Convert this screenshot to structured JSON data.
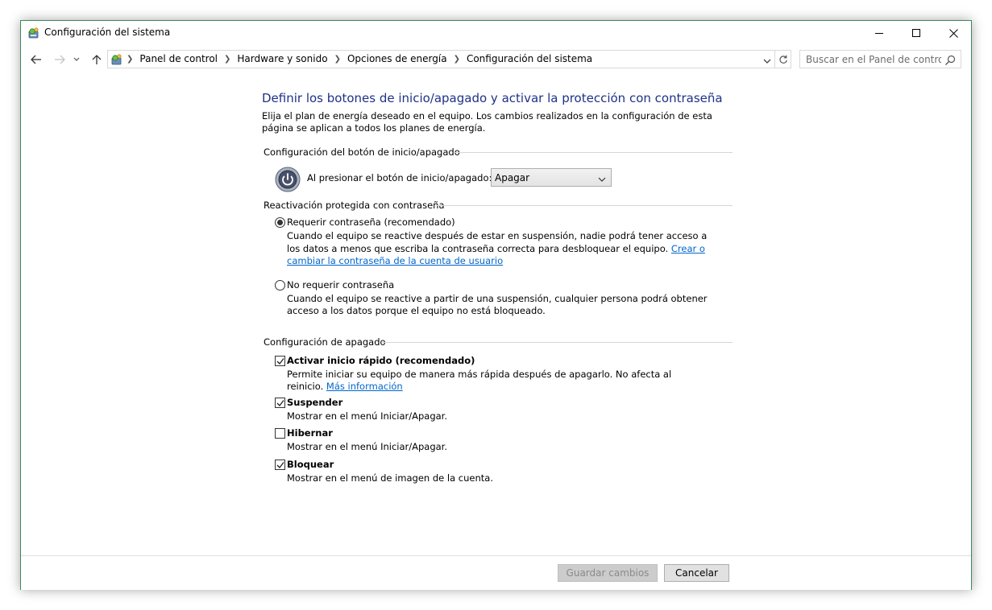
{
  "window": {
    "title": "Configuración del sistema",
    "accent_color": "#3b8b5b"
  },
  "titlebar": {
    "icon": "control-panel-icon",
    "minimize_icon": "minimize-icon",
    "maximize_icon": "maximize-icon",
    "close_icon": "close-icon"
  },
  "address": {
    "breadcrumbs": [
      "Panel de control",
      "Hardware y sonido",
      "Opciones de energía",
      "Configuración del sistema"
    ],
    "search_placeholder": "Buscar en el Panel de control"
  },
  "main": {
    "heading": "Definir los botones de inicio/apagado y activar la protección con contraseña",
    "description": "Elija el plan de energía deseado en el equipo. Los cambios realizados en la configuración de esta página se aplican a todos los planes de energía.",
    "power_group": {
      "title": "Configuración del botón de inicio/apagado",
      "label": "Al presionar el botón de inicio/apagado:",
      "selected": "Apagar"
    },
    "password_group": {
      "title": "Reactivación protegida con contraseña",
      "options": [
        {
          "label": "Requerir contraseña (recomendado)",
          "selected": true,
          "desc": "Cuando el equipo se reactive después de estar en suspensión, nadie podrá tener acceso a los datos a menos que escriba la contraseña correcta para desbloquear el equipo. ",
          "link": "Crear o cambiar la contraseña de la cuenta de usuario"
        },
        {
          "label": "No requerir contraseña",
          "selected": false,
          "desc": "Cuando el equipo se reactive a partir de una suspensión, cualquier persona podrá obtener acceso a los datos porque el equipo no está bloqueado."
        }
      ]
    },
    "shutdown_group": {
      "title": "Configuración de apagado",
      "items": [
        {
          "label": "Activar inicio rápido (recomendado)",
          "checked": true,
          "desc": "Permite iniciar su equipo de manera más rápida después de apagarlo. No afecta al reinicio. ",
          "link": "Más información"
        },
        {
          "label": "Suspender",
          "checked": true,
          "desc": "Mostrar en el menú Iniciar/Apagar."
        },
        {
          "label": "Hibernar",
          "checked": false,
          "desc": "Mostrar en el menú Iniciar/Apagar."
        },
        {
          "label": "Bloquear",
          "checked": true,
          "desc": "Mostrar en el menú de imagen de la cuenta."
        }
      ]
    }
  },
  "footer": {
    "save_label": "Guardar cambios",
    "cancel_label": "Cancelar"
  }
}
